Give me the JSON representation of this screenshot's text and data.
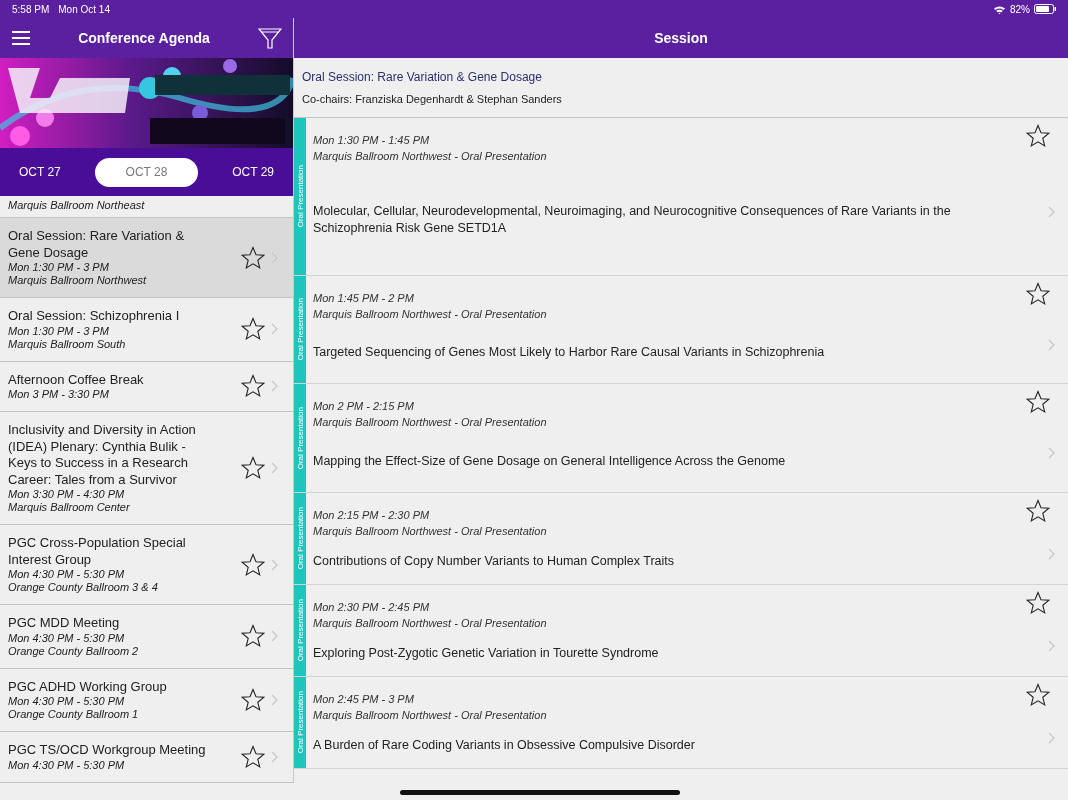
{
  "status_bar": {
    "time": "5:58 PM",
    "date": "Mon Oct 14",
    "battery": "82%"
  },
  "agenda": {
    "title": "Conference Agenda",
    "dates": [
      {
        "label": "OCT 27",
        "selected": false
      },
      {
        "label": "OCT 28",
        "selected": true
      },
      {
        "label": "OCT 29",
        "selected": false
      }
    ],
    "items": [
      {
        "location": "Marquis Ballroom Northeast",
        "selected": false
      },
      {
        "title": "Oral Session: Rare Variation & Gene Dosage",
        "time": "Mon 1:30 PM - 3 PM",
        "location": "Marquis Ballroom Northwest",
        "selected": true,
        "favorite": false
      },
      {
        "title": "Oral Session: Schizophrenia I",
        "time": "Mon 1:30 PM - 3 PM",
        "location": "Marquis Ballroom South",
        "selected": false,
        "favorite": false
      },
      {
        "title": "Afternoon Coffee Break",
        "time": "Mon 3 PM - 3:30 PM",
        "selected": false,
        "favorite": false
      },
      {
        "title": "Inclusivity and Diversity in Action (IDEA) Plenary: Cynthia Bulik - Keys to Success in a Research Career: Tales from a Survivor",
        "time": "Mon 3:30 PM - 4:30 PM",
        "location": "Marquis Ballroom Center",
        "selected": false,
        "favorite": false
      },
      {
        "title": "PGC Cross-Population Special Interest Group",
        "time": "Mon 4:30 PM - 5:30 PM",
        "location": "Orange County Ballroom 3 & 4",
        "selected": false,
        "favorite": false
      },
      {
        "title": "PGC MDD Meeting",
        "time": "Mon 4:30 PM - 5:30 PM",
        "location": "Orange County Ballroom 2",
        "selected": false,
        "favorite": false
      },
      {
        "title": "PGC ADHD Working Group",
        "time": "Mon 4:30 PM - 5:30 PM",
        "location": "Orange County Ballroom 1",
        "selected": false,
        "favorite": false
      },
      {
        "title": "PGC TS/OCD Workgroup Meeting",
        "time": "Mon 4:30 PM - 5:30 PM",
        "selected": false,
        "favorite": false
      }
    ]
  },
  "session": {
    "header": "Session",
    "title": "Oral Session: Rare Variation & Gene Dosage",
    "cochairs": "Co-chairs: Franziska Degenhardt & Stephan Sanders",
    "talks": [
      {
        "tag": "Oral Presentation",
        "time": "Mon 1:30 PM - 1:45 PM",
        "location": "Marquis Ballroom Northwest - Oral Presentation",
        "title": "Molecular, Cellular, Neurodevelopmental, Neuroimaging, and Neurocognitive Consequences of Rare Variants in the Schizophrenia Risk Gene SETD1A",
        "favorite": false
      },
      {
        "tag": "Oral Presentation",
        "time": "Mon 1:45 PM - 2 PM",
        "location": "Marquis Ballroom Northwest - Oral Presentation",
        "title": "Targeted Sequencing of Genes Most Likely to Harbor Rare Causal Variants in Schizophrenia",
        "favorite": false
      },
      {
        "tag": "Oral Presentation",
        "time": "Mon 2 PM - 2:15 PM",
        "location": "Marquis Ballroom Northwest - Oral Presentation",
        "title": "Mapping the Effect-Size of Gene Dosage on General Intelligence Across the Genome",
        "favorite": false
      },
      {
        "tag": "Oral Presentation",
        "time": "Mon 2:15 PM - 2:30 PM",
        "location": "Marquis Ballroom Northwest - Oral Presentation",
        "title": "Contributions of Copy Number Variants to Human Complex Traits",
        "favorite": false
      },
      {
        "tag": "Oral Presentation",
        "time": "Mon 2:30 PM - 2:45 PM",
        "location": "Marquis Ballroom Northwest - Oral Presentation",
        "title": "Exploring Post-Zygotic Genetic Variation in Tourette Syndrome",
        "favorite": false
      },
      {
        "tag": "Oral Presentation",
        "time": "Mon 2:45 PM - 3 PM",
        "location": "Marquis Ballroom Northwest - Oral Presentation",
        "title": "A Burden of Rare Coding Variants in Obsessive Compulsive Disorder",
        "favorite": false
      }
    ]
  }
}
